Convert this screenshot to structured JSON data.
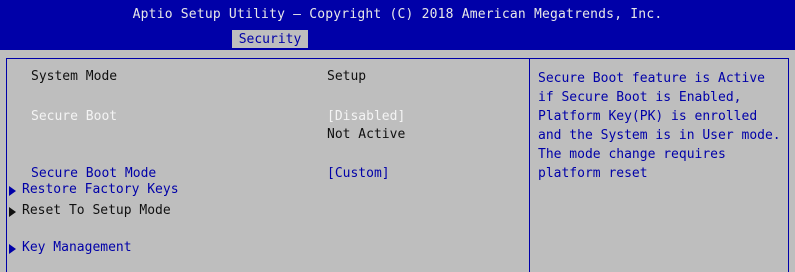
{
  "header": {
    "title": "Aptio Setup Utility – Copyright (C) 2018 American Megatrends, Inc.",
    "active_tab": "Security"
  },
  "colors": {
    "header_bg": "#0000a8",
    "panel_bg": "#bebebe",
    "link_text": "#0000a8",
    "selected_text": "#f4f4f4"
  },
  "settings": {
    "system_mode": {
      "label": "System Mode",
      "value": "Setup"
    },
    "secure_boot": {
      "label": "Secure Boot",
      "value": "[Disabled]",
      "status": "Not Active"
    },
    "secure_boot_mode": {
      "label": "Secure Boot Mode",
      "value": "[Custom]"
    },
    "restore_factory_keys": {
      "label": "Restore Factory Keys",
      "icon": "triangle-right-icon"
    },
    "reset_to_setup_mode": {
      "label": "Reset To Setup Mode",
      "icon": "triangle-right-icon"
    },
    "key_management": {
      "label": "Key Management",
      "icon": "triangle-right-icon"
    }
  },
  "help": {
    "lines": [
      "Secure Boot feature is Active",
      "if Secure Boot is Enabled,",
      "Platform Key(PK) is enrolled",
      "and the System is in User mode.",
      "The mode change requires",
      "platform reset"
    ]
  }
}
